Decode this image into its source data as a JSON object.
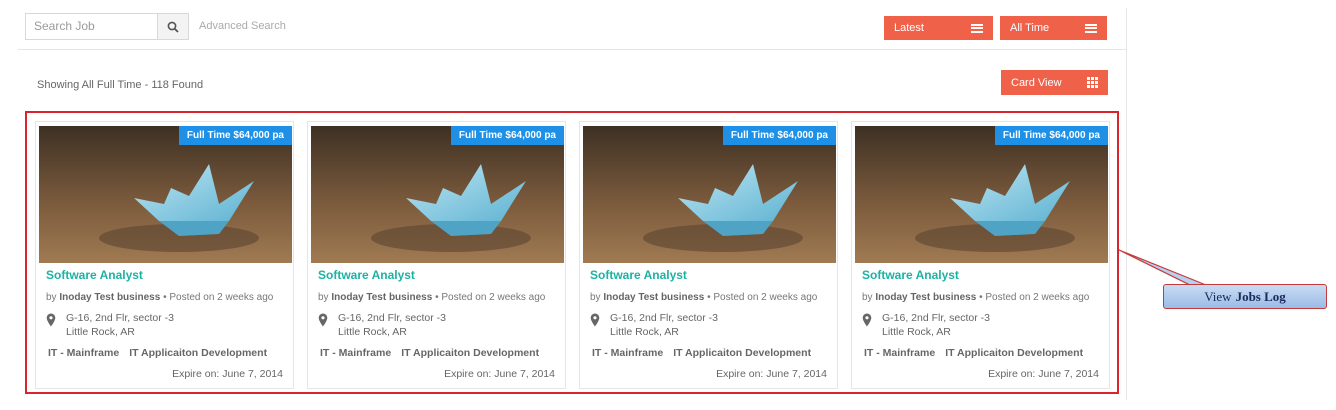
{
  "search": {
    "placeholder": "Search Job",
    "advanced_label": "Advanced Search"
  },
  "filters": {
    "sort_label": "Latest",
    "period_label": "All Time"
  },
  "results": {
    "summary": "Showing All Full Time - 118 Found",
    "view_label": "Card View"
  },
  "jobs": [
    {
      "badge": "Full Time $64,000 pa",
      "title": "Software Analyst",
      "by_prefix": "by",
      "company": "Inoday Test business",
      "posted": "Posted on 2 weeks ago",
      "address_line1": "G-16, 2nd Flr, sector -3",
      "address_line2": "Little Rock, AR",
      "tag1": "IT - Mainframe",
      "tag2": "IT Applicaiton Development",
      "expire": "Expire on: June 7, 2014"
    },
    {
      "badge": "Full Time $64,000 pa",
      "title": "Software Analyst",
      "by_prefix": "by",
      "company": "Inoday Test business",
      "posted": "Posted on 2 weeks ago",
      "address_line1": "G-16, 2nd Flr, sector -3",
      "address_line2": "Little Rock, AR",
      "tag1": "IT - Mainframe",
      "tag2": "IT Applicaiton Development",
      "expire": "Expire on: June 7, 2014"
    },
    {
      "badge": "Full Time $64,000 pa",
      "title": "Software Analyst",
      "by_prefix": "by",
      "company": "Inoday Test business",
      "posted": "Posted on 2 weeks ago",
      "address_line1": "G-16, 2nd Flr, sector -3",
      "address_line2": "Little Rock, AR",
      "tag1": "IT - Mainframe",
      "tag2": "IT Applicaiton Development",
      "expire": "Expire on: June 7, 2014"
    },
    {
      "badge": "Full Time $64,000 pa",
      "title": "Software Analyst",
      "by_prefix": "by",
      "company": "Inoday Test business",
      "posted": "Posted on 2 weeks ago",
      "address_line1": "G-16, 2nd Flr, sector -3",
      "address_line2": "Little Rock, AR",
      "tag1": "IT - Mainframe",
      "tag2": "IT Applicaiton Development",
      "expire": "Expire on: June 7, 2014"
    }
  ],
  "callout": {
    "prefix": "View",
    "emphasis": "Jobs Log"
  },
  "colors": {
    "accent": "#f0614a",
    "badge": "#1e90e6",
    "title": "#1bb3a3",
    "outline": "#d9232d"
  }
}
